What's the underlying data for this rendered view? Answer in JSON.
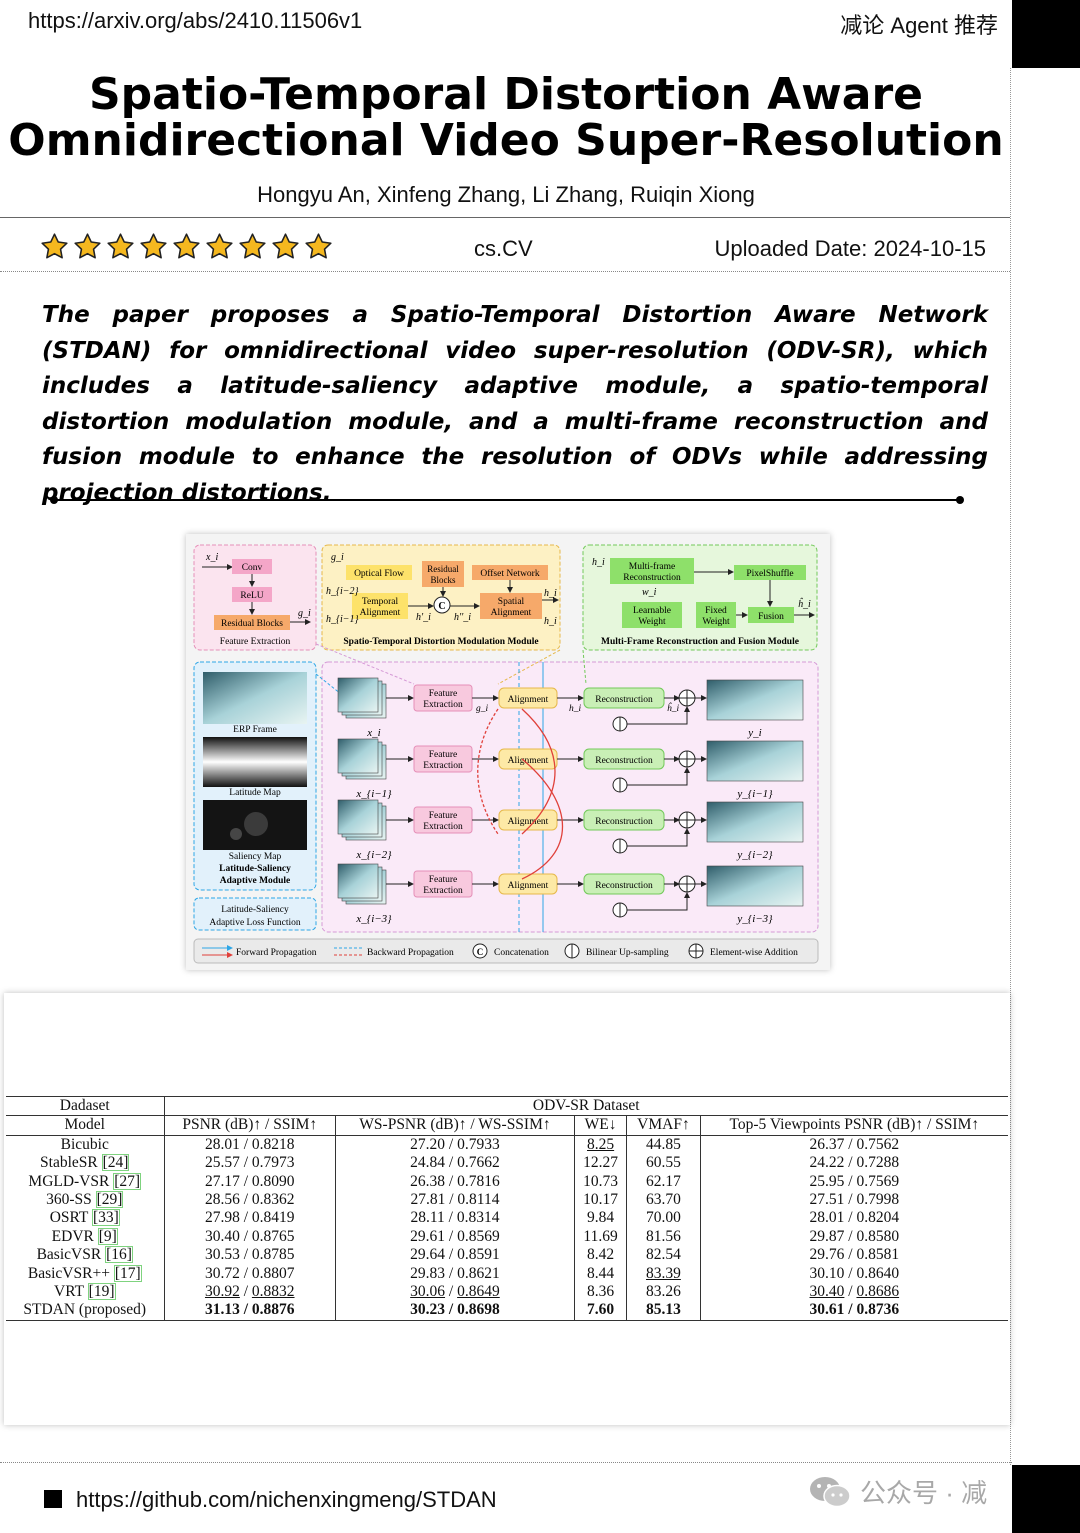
{
  "header": {
    "url": "https://arxiv.org/abs/2410.11506v1",
    "brand": "减论 Agent 推荐"
  },
  "paper": {
    "title_line1": "Spatio-Temporal Distortion Aware",
    "title_line2": "Omnidirectional Video Super-Resolution",
    "authors": "Hongyu An, Xinfeng Zhang, Li Zhang, Ruiqin Xiong",
    "rating_stars": 9,
    "category": "cs.CV",
    "uploaded": "Uploaded Date: 2024-10-15",
    "summary": "The paper proposes a Spatio-Temporal Distortion Aware Network (STDAN) for omnidirectional video super-resolution (ODV-SR), which includes a latitude-saliency adaptive module, a spatio-temporal distortion modulation module, and a multi-frame reconstruction and fusion module to enhance the resolution of ODVs while addressing projection distortions."
  },
  "figure": {
    "fe_block": {
      "input": "x_i",
      "conv": "Conv",
      "relu": "ReLU",
      "res": "Residual Blocks",
      "output": "g_i",
      "caption": "Feature Extraction"
    },
    "stdm_block": {
      "g": "g_i",
      "optical_flow": "Optical Flow",
      "residual_blocks": "Residual Blocks",
      "offset": "Offset Network",
      "temporal": "Temporal Alignment",
      "spatial": "Spatial Alignment",
      "concat": "C",
      "h_im2": "h_{i−2}",
      "h_im1": "h_{i−1}",
      "hp": "h'_i",
      "hpp": "h''_i",
      "h_out": "h_i",
      "caption": "Spatio-Temporal Distortion Modulation Module"
    },
    "mfrf_block": {
      "h": "h_i",
      "multi": "Multi-frame Reconstruction",
      "pixelshuffle": "PixelShuffle",
      "w": "w_i",
      "learnable": "Learnable Weight",
      "fixed": "Fixed Weight",
      "fusion": "Fusion",
      "out": "ĥ_i",
      "caption": "Multi-Frame Reconstruction and Fusion Module"
    },
    "left_panel": {
      "erp": "ERP Frame",
      "lat": "Latitude Map",
      "sal": "Saliency Map",
      "module": "Latitude-Saliency Adaptive Module",
      "loss": "Latitude-Saliency Adaptive Loss Function"
    },
    "rows": [
      {
        "x": "x_i",
        "fe": "Feature Extraction",
        "align": "Alignment",
        "recon": "Reconstruction",
        "y": "y_i"
      },
      {
        "x": "x_{i−1}",
        "fe": "Feature Extraction",
        "align": "Alignment",
        "recon": "Reconstruction",
        "y": "y_{i−1}"
      },
      {
        "x": "x_{i−2}",
        "fe": "Feature Extraction",
        "align": "Alignment",
        "recon": "Reconstruction",
        "y": "y_{i−2}"
      },
      {
        "x": "x_{i−3}",
        "fe": "Feature Extraction",
        "align": "Alignment",
        "recon": "Reconstruction",
        "y": "y_{i−3}"
      }
    ],
    "row_labels": {
      "g": "g_i",
      "h": "h_i",
      "hhat": "ĥ_i"
    },
    "legend": [
      "Forward Propagation",
      "Backward Propagation",
      "Concatenation",
      "Bilinear Up-sampling",
      "Element-wise Addition"
    ],
    "colors": {
      "pink": "#f6c6dc",
      "yellow": "#fde9a6",
      "green": "#c9efb6",
      "blue_panel": "#d7ecfa",
      "red": "#e0403a",
      "blue": "#2ea6e6"
    }
  },
  "table": {
    "header1": {
      "dataset_label": "Dadaset",
      "dataset_name": "ODV-SR Dataset"
    },
    "columns": [
      "Model",
      "PSNR (dB)↑ / SSIM↑",
      "WS-PSNR (dB)↑ / WS-SSIM↑",
      "WE↓",
      "VMAF↑",
      "Top-5 Viewpoints PSNR (dB)↑ / SSIM↑"
    ],
    "rows": [
      {
        "model": "Bicubic",
        "ref": "",
        "psnr": "28.01 / 0.8218",
        "wspsnr": "27.20 / 0.7933",
        "we": "8.25",
        "vmaf": "44.85",
        "top5": "26.37 / 0.7562"
      },
      {
        "model": "StableSR",
        "ref": "[24]",
        "psnr": "25.57 / 0.7973",
        "wspsnr": "24.84 / 0.7662",
        "we": "12.27",
        "vmaf": "60.55",
        "top5": "24.22 / 0.7288"
      },
      {
        "model": "MGLD-VSR",
        "ref": "[27]",
        "psnr": "27.17 / 0.8090",
        "wspsnr": "26.38 / 0.7816",
        "we": "10.73",
        "vmaf": "62.17",
        "top5": "25.95 / 0.7569"
      },
      {
        "model": "360-SS",
        "ref": "[29]",
        "psnr": "28.56 / 0.8362",
        "wspsnr": "27.81 / 0.8114",
        "we": "10.17",
        "vmaf": "63.70",
        "top5": "27.51 / 0.7998"
      },
      {
        "model": "OSRT",
        "ref": "[33]",
        "psnr": "27.98 / 0.8419",
        "wspsnr": "28.11 / 0.8314",
        "we": "9.84",
        "vmaf": "70.00",
        "top5": "28.01 / 0.8204"
      },
      {
        "model": "EDVR",
        "ref": "[9]",
        "psnr": "30.40 / 0.8765",
        "wspsnr": "29.61 / 0.8569",
        "we": "11.69",
        "vmaf": "81.56",
        "top5": "29.87 / 0.8580"
      },
      {
        "model": "BasicVSR",
        "ref": "[16]",
        "psnr": "30.53 / 0.8785",
        "wspsnr": "29.64 / 0.8591",
        "we": "8.42",
        "vmaf": "82.54",
        "top5": "29.76 / 0.8581"
      },
      {
        "model": "BasicVSR++",
        "ref": "[17]",
        "psnr": "30.72 / 0.8807",
        "wspsnr": "29.83 / 0.8621",
        "we": "8.44",
        "vmaf": "83.39",
        "top5": "30.10 / 0.8640"
      },
      {
        "model": "VRT",
        "ref": "[19]",
        "psnr_a": "30.92",
        "psnr_b": "0.8832",
        "wspsnr_a": "30.06",
        "wspsnr_b": "0.8649",
        "we": "8.36",
        "vmaf": "83.26",
        "top5_a": "30.40",
        "top5_b": "0.8686"
      },
      {
        "model": "STDAN (proposed)",
        "ref": "",
        "psnr": "31.13 / 0.8876",
        "wspsnr": "30.23 / 0.8698",
        "we": "7.60",
        "vmaf": "85.13",
        "top5": "30.61 / 0.8736"
      }
    ]
  },
  "footer": {
    "github": "https://github.com/nichenxingmeng/STDAN",
    "watermark": "公众号 · 减"
  }
}
